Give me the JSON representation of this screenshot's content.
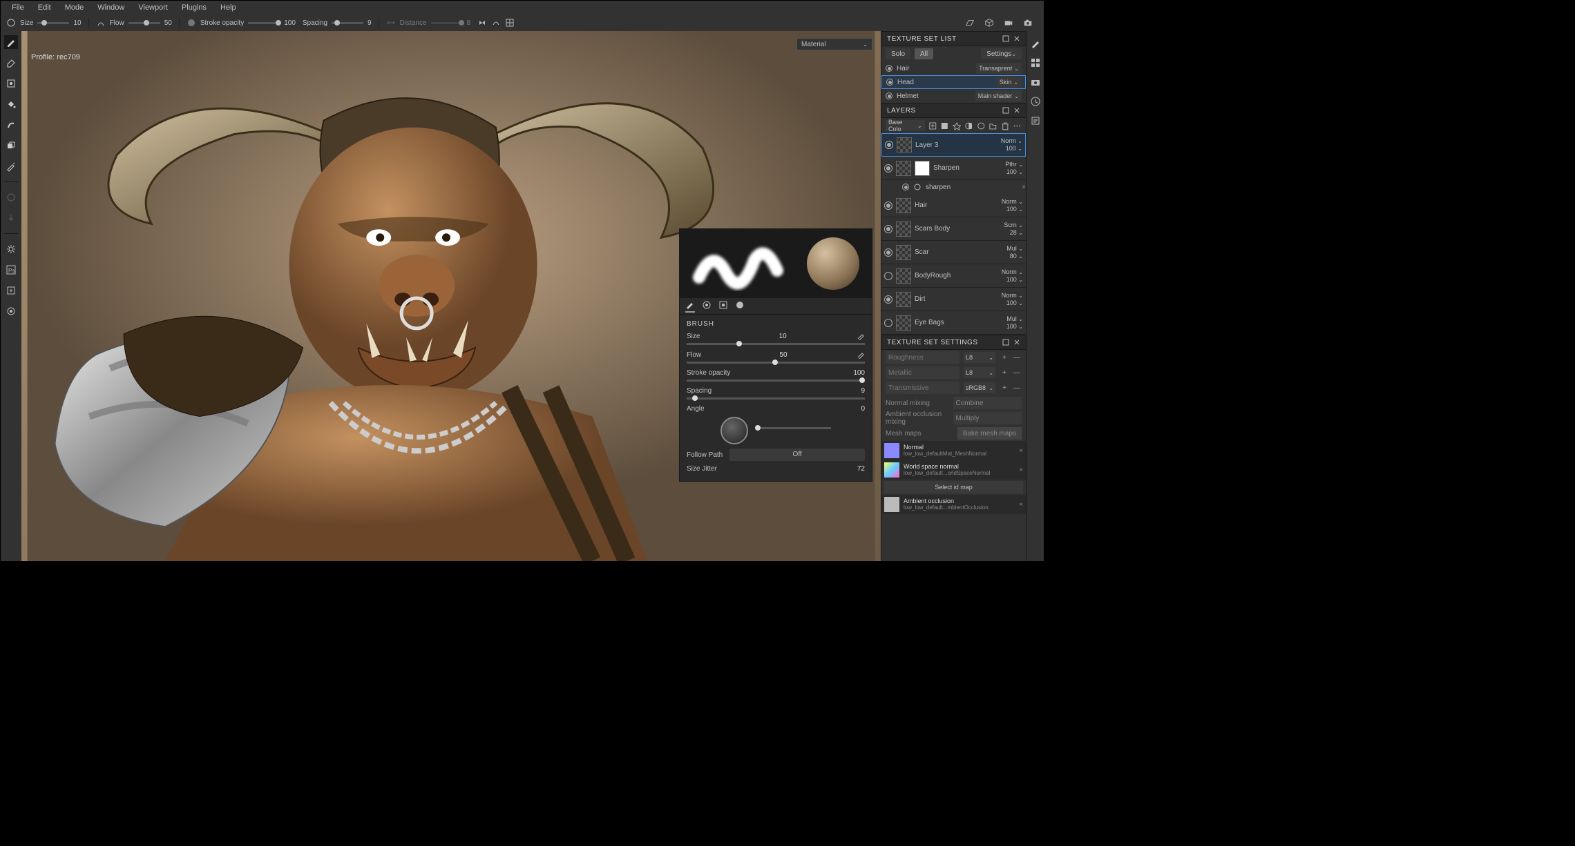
{
  "menu": [
    "File",
    "Edit",
    "Mode",
    "Window",
    "Viewport",
    "Plugins",
    "Help"
  ],
  "toolbar": {
    "size_label": "Size",
    "size_val": "10",
    "flow_label": "Flow",
    "flow_val": "50",
    "stroke_label": "Stroke opacity",
    "stroke_val": "100",
    "spacing_label": "Spacing",
    "spacing_val": "9",
    "distance_label": "Distance",
    "distance_val": "8"
  },
  "viewport": {
    "profile": "Profile: rec709",
    "material_dropdown": "Material"
  },
  "brushpanel": {
    "title": "BRUSH",
    "size_label": "Size",
    "size_val": "10",
    "flow_label": "Flow",
    "flow_val": "50",
    "stroke_label": "Stroke opacity",
    "stroke_val": "100",
    "spacing_label": "Spacing",
    "spacing_val": "9",
    "angle_label": "Angle",
    "angle_val": "0",
    "follow_label": "Follow Path",
    "follow_val": "Off",
    "jitter_label": "Size Jitter",
    "jitter_val": "72"
  },
  "texset": {
    "title": "TEXTURE SET LIST",
    "solo": "Solo",
    "all": "All",
    "settings": "Settings",
    "items": [
      {
        "name": "Hair",
        "shader": "Transaprent"
      },
      {
        "name": "Head",
        "shader": "Skin"
      },
      {
        "name": "Helmet",
        "shader": "Main shader"
      }
    ]
  },
  "layers": {
    "title": "LAYERS",
    "channel": "Base Colo",
    "items": [
      {
        "name": "Layer 3",
        "blend": "Norm",
        "opacity": "100",
        "vis": true,
        "sel": true,
        "mask": false
      },
      {
        "name": "Sharpen",
        "blend": "Pthr",
        "opacity": "100",
        "vis": true,
        "mask": true,
        "effect": "sharpen"
      },
      {
        "name": "Hair",
        "blend": "Norm",
        "opacity": "100",
        "vis": true,
        "mask": false
      },
      {
        "name": "Scars Body",
        "blend": "Scrn",
        "opacity": "28",
        "vis": true,
        "mask": false
      },
      {
        "name": "Scar",
        "blend": "Mul",
        "opacity": "80",
        "vis": true,
        "mask": false
      },
      {
        "name": "BodyRough",
        "blend": "Norm",
        "opacity": "100",
        "vis": false,
        "mask": false
      },
      {
        "name": "Dirt",
        "blend": "Norm",
        "opacity": "100",
        "vis": true,
        "mask": false
      },
      {
        "name": "Eye Bags",
        "blend": "Mul",
        "opacity": "100",
        "vis": false,
        "mask": false
      }
    ]
  },
  "tss": {
    "title": "TEXTURE SET SETTINGS",
    "channels": [
      {
        "name": "Roughness",
        "fmt": "L8"
      },
      {
        "name": "Metallic",
        "fmt": "L8"
      },
      {
        "name": "Transmissive",
        "fmt": "sRGB8"
      }
    ],
    "normal_mixing_label": "Normal mixing",
    "normal_mixing_val": "Combine",
    "ao_mixing_label": "Ambient occlusion mixing",
    "ao_mixing_val": "Multiply",
    "mesh_maps_label": "Mesh maps",
    "bake_label": "Bake mesh maps",
    "maps": [
      {
        "name": "Normal",
        "file": "low_low_defaultMat_MeshNormal",
        "color": "#8a8aff"
      },
      {
        "name": "World space normal",
        "file": "low_low_default...orldSpaceNormal",
        "color": "linear-gradient(135deg,#ff6,#6cf,#f6c)"
      },
      {
        "name": "Ambient occlusion",
        "file": "low_low_default...mbientOcclusion",
        "color": "#bbb"
      }
    ],
    "idmap": "Select id map"
  }
}
